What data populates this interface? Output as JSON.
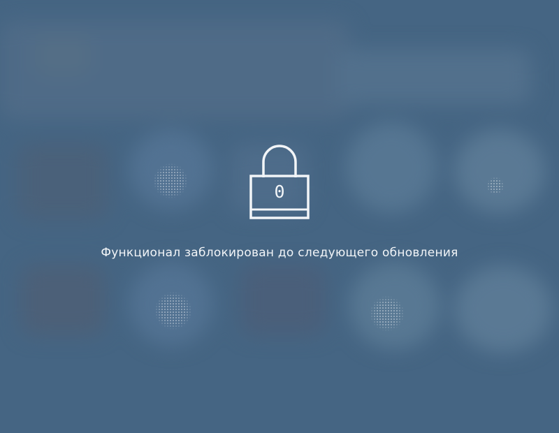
{
  "lock_overlay": {
    "counter": "0",
    "message": "Функционал заблокирован до следующего обновления"
  },
  "colors": {
    "background": "#456583",
    "overlay_foreground": "#f2f5f8"
  },
  "icons": [
    "lock-icon",
    "blurred-dashboard-background"
  ]
}
